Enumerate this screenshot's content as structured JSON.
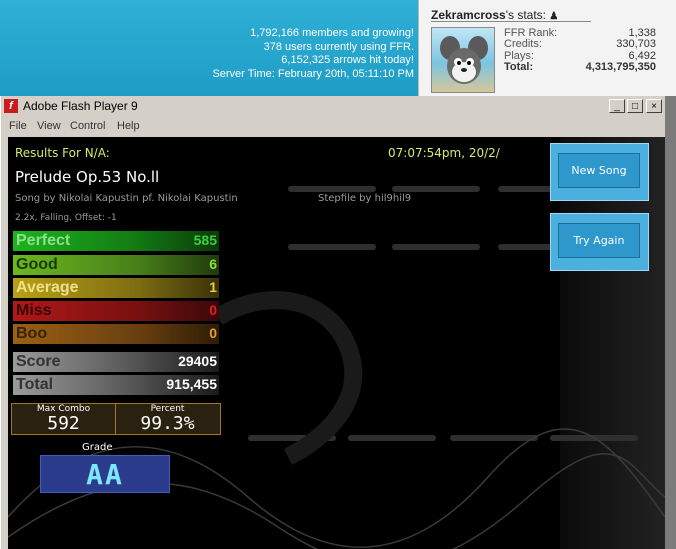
{
  "site": {
    "stats_lines": [
      "1,792,166 members and growing!",
      "378 users currently using FFR.",
      "6,152,325 arrows hit today!",
      "Server Time: February 20th, 05:11:10 PM"
    ]
  },
  "profile": {
    "username": "Zekramcross",
    "stats_suffix": "'s stats:",
    "rows": [
      {
        "label": "FFR Rank:",
        "value": "1,338"
      },
      {
        "label": "Credits:",
        "value": "330,703"
      },
      {
        "label": "Plays:",
        "value": "6,492"
      },
      {
        "label": "Total:",
        "value": "4,313,795,350"
      }
    ]
  },
  "window": {
    "title": "Adobe Flash Player 9",
    "menu": [
      "File",
      "View",
      "Control",
      "Help"
    ],
    "controls": [
      "_",
      "□",
      "×"
    ]
  },
  "results": {
    "header": "Results For N/A:",
    "timestamp": "07:07:54pm, 20/2/",
    "song_title": "Prelude Op.53 No.ll",
    "credits": "Song by Nikolai Kapustin pf. Nikolai Kapustin",
    "stepfile": "Stepfile by hil9hil9",
    "settings": "2.2x, Falling, Offset: -1",
    "judgements": [
      {
        "label": "Perfect",
        "value": "585",
        "color": "#1db31d",
        "text": "#3dcf3d"
      },
      {
        "label": "Good",
        "value": "6",
        "color": "#6bb81e",
        "text": "#8ce03a"
      },
      {
        "label": "Average",
        "value": "1",
        "color": "#b8a117",
        "text": "#e8d23a"
      },
      {
        "label": "Miss",
        "value": "0",
        "color": "#b01818",
        "text": "#e02020"
      },
      {
        "label": "Boo",
        "value": "0",
        "color": "#9b5f14",
        "text": "#e0a030"
      }
    ],
    "score": {
      "label": "Score",
      "value": "29405"
    },
    "total": {
      "label": "Total",
      "value": "915,455"
    },
    "max_combo": {
      "label": "Max Combo",
      "value": "592"
    },
    "percent": {
      "label": "Percent",
      "value": "99.3%"
    },
    "grade_label": "Grade",
    "grade": "AA"
  },
  "buttons": {
    "new_song": "New Song",
    "try_again": "Try Again"
  }
}
